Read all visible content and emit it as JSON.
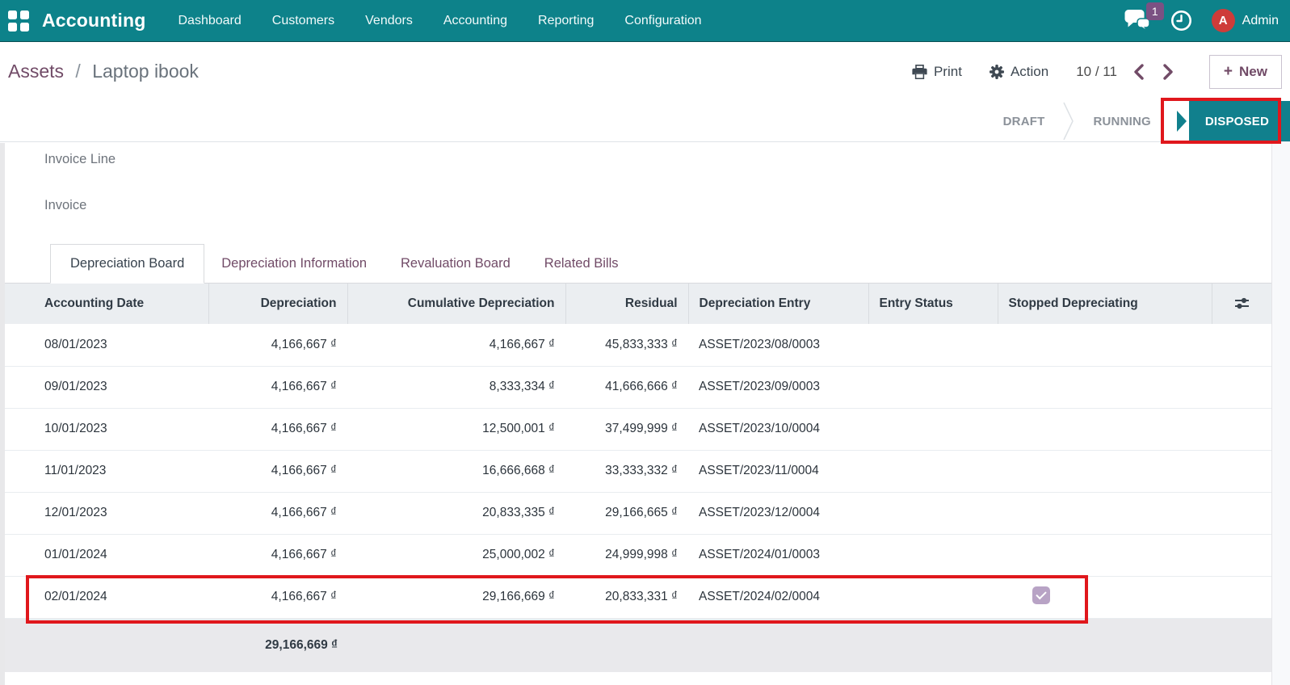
{
  "navbar": {
    "app_name": "Accounting",
    "menu_items": [
      "Dashboard",
      "Customers",
      "Vendors",
      "Accounting",
      "Reporting",
      "Configuration"
    ],
    "messages_badge": "1",
    "user_initial": "A",
    "user_name": "Admin"
  },
  "breadcrumb": {
    "parent": "Assets",
    "separator": "/",
    "current": "Laptop ibook"
  },
  "control_panel": {
    "print_label": "Print",
    "action_label": "Action",
    "pager_value": "10 / 11",
    "new_plus": "+",
    "new_label": "New"
  },
  "statusbar": {
    "states": [
      "DRAFT",
      "RUNNING",
      "DISPOSED"
    ],
    "active_state": "DISPOSED"
  },
  "form_fields": {
    "invoice_line_label": "Invoice Line",
    "invoice_label": "Invoice"
  },
  "tabs": {
    "items": [
      "Depreciation Board",
      "Depreciation Information",
      "Revaluation Board",
      "Related Bills"
    ],
    "active": "Depreciation Board"
  },
  "table": {
    "columns": [
      "Accounting Date",
      "Depreciation",
      "Cumulative Depreciation",
      "Residual",
      "Depreciation Entry",
      "Entry Status",
      "Stopped Depreciating"
    ],
    "rows": [
      {
        "accounting_date": "08/01/2023",
        "depreciation": "4,166,667 ₫",
        "cumulative_depreciation": "4,166,667 ₫",
        "residual": "45,833,333 ₫",
        "depreciation_entry": "ASSET/2023/08/0003",
        "entry_status": "",
        "stopped_depreciating": false,
        "highlighted": false
      },
      {
        "accounting_date": "09/01/2023",
        "depreciation": "4,166,667 ₫",
        "cumulative_depreciation": "8,333,334 ₫",
        "residual": "41,666,666 ₫",
        "depreciation_entry": "ASSET/2023/09/0003",
        "entry_status": "",
        "stopped_depreciating": false,
        "highlighted": false
      },
      {
        "accounting_date": "10/01/2023",
        "depreciation": "4,166,667 ₫",
        "cumulative_depreciation": "12,500,001 ₫",
        "residual": "37,499,999 ₫",
        "depreciation_entry": "ASSET/2023/10/0004",
        "entry_status": "",
        "stopped_depreciating": false,
        "highlighted": false
      },
      {
        "accounting_date": "11/01/2023",
        "depreciation": "4,166,667 ₫",
        "cumulative_depreciation": "16,666,668 ₫",
        "residual": "33,333,332 ₫",
        "depreciation_entry": "ASSET/2023/11/0004",
        "entry_status": "",
        "stopped_depreciating": false,
        "highlighted": false
      },
      {
        "accounting_date": "12/01/2023",
        "depreciation": "4,166,667 ₫",
        "cumulative_depreciation": "20,833,335 ₫",
        "residual": "29,166,665 ₫",
        "depreciation_entry": "ASSET/2023/12/0004",
        "entry_status": "",
        "stopped_depreciating": false,
        "highlighted": false
      },
      {
        "accounting_date": "01/01/2024",
        "depreciation": "4,166,667 ₫",
        "cumulative_depreciation": "25,000,002 ₫",
        "residual": "24,999,998 ₫",
        "depreciation_entry": "ASSET/2024/01/0003",
        "entry_status": "",
        "stopped_depreciating": false,
        "highlighted": false
      },
      {
        "accounting_date": "02/01/2024",
        "depreciation": "4,166,667 ₫",
        "cumulative_depreciation": "29,166,669 ₫",
        "residual": "20,833,331 ₫",
        "depreciation_entry": "ASSET/2024/02/0004",
        "entry_status": "",
        "stopped_depreciating": true,
        "highlighted": true
      }
    ],
    "total_depreciation": "29,166,669 ₫"
  },
  "colors": {
    "navbar_teal": "#0d828a",
    "active_state_teal": "#11808d",
    "brand_purple": "#714B67",
    "annotation_red": "#e0171c",
    "avatar_red": "#ce3c39",
    "badge_purple": "#7b5183",
    "checkbox_purple": "#b8a3c5",
    "header_gray": "#ebeef1"
  }
}
